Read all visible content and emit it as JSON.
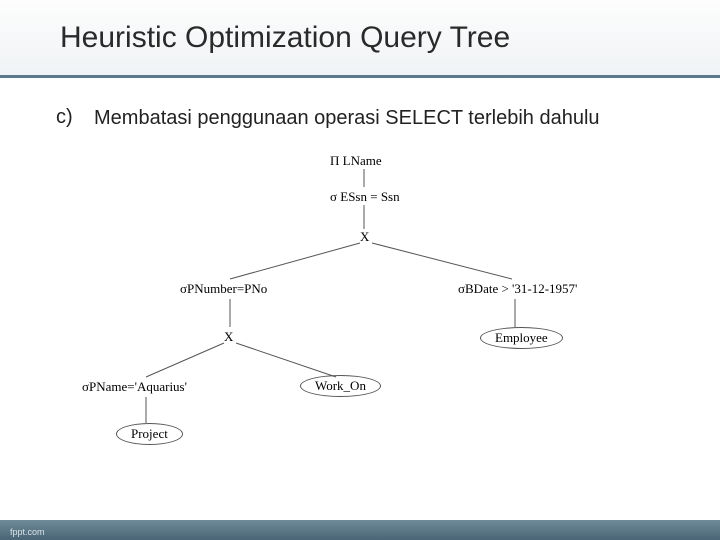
{
  "slide": {
    "title": "Heuristic Optimization Query Tree",
    "bullet_marker": "c)",
    "bullet_text": "Membatasi penggunaan operasi SELECT terlebih dahulu"
  },
  "tree": {
    "root_project": "Π LName",
    "sel_essn": "σ ESsn = Ssn",
    "join1": "X",
    "sel_pnumber": "σPNumber=PNo",
    "sel_bdate": "σBDate > '31-12-1957'",
    "join2": "X",
    "rel_employee": "Employee",
    "sel_pname": "σPName='Aquarius'",
    "rel_works_on": "Work_On",
    "rel_project": "Project"
  },
  "footer": {
    "site": "fppt.com"
  }
}
